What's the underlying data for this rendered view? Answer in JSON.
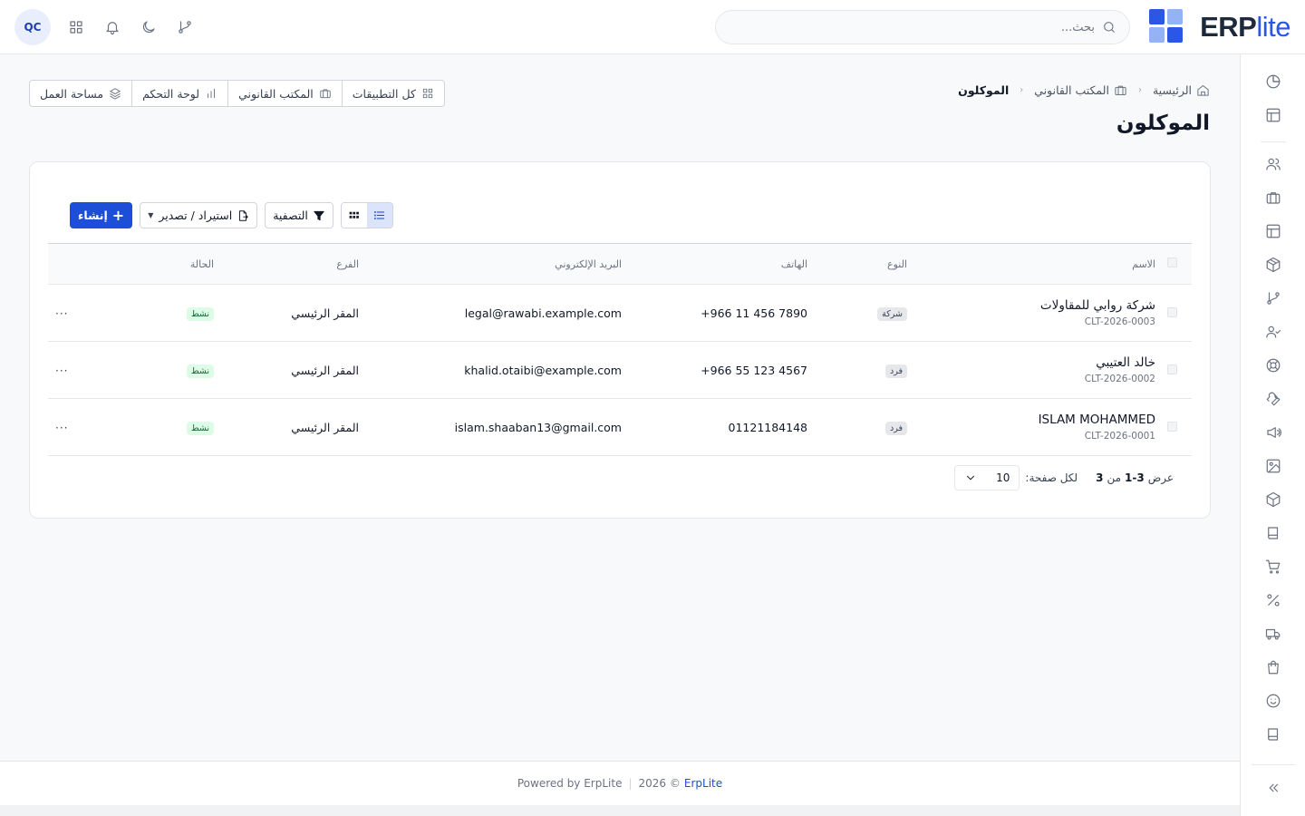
{
  "brand": {
    "name_main": "ERP",
    "name_accent": "lite",
    "colors": {
      "accent": "#2b56e6",
      "dark": "#1e293b"
    }
  },
  "header": {
    "search_placeholder": "بحث...",
    "avatar_initials": "QC",
    "icons": [
      "grid-icon",
      "bell-icon",
      "moon-icon",
      "git-branch-icon"
    ]
  },
  "breadcrumb": {
    "home": "الرئيسية",
    "section": "المكتب القانوني",
    "current": "الموكلون"
  },
  "page_title": "الموكلون",
  "quick_links": {
    "all_apps": "كل التطبيقات",
    "legal_office": "المكتب القانوني",
    "dashboard": "لوحة التحكم",
    "workspace": "مساحة العمل"
  },
  "toolbar": {
    "create": "إنشاء",
    "import_export": "استيراد / تصدير",
    "filter": "التصفية"
  },
  "table": {
    "columns": {
      "name": "الاسم",
      "type": "النوع",
      "phone": "الهاتف",
      "email": "البريد الإلكتروني",
      "branch": "الفرع",
      "status": "الحالة"
    },
    "rows": [
      {
        "name": "شركة روابي للمقاولات",
        "code": "CLT-2026-0003",
        "type": "شركة",
        "phone": "+966 11 456 7890",
        "email": "legal@rawabi.example.com",
        "branch": "المقر الرئيسي",
        "status": "نشط",
        "more": "···"
      },
      {
        "name": "خالد العتيبي",
        "code": "CLT-2026-0002",
        "type": "فرد",
        "phone": "+966 55 123 4567",
        "email": "khalid.otaibi@example.com",
        "branch": "المقر الرئيسي",
        "status": "نشط",
        "more": "···"
      },
      {
        "name": "ISLAM MOHAMMED",
        "code": "CLT-2026-0001",
        "type": "فرد",
        "phone": "01121184148",
        "email": "islam.shaaban13@gmail.com",
        "branch": "المقر الرئيسي",
        "status": "نشط",
        "more": "···"
      }
    ]
  },
  "pagination": {
    "show": "عرض",
    "range": "1-3",
    "of": "من",
    "total": "3",
    "per_page_label": "لكل صفحة:",
    "per_page_value": "10"
  },
  "footer": {
    "powered": "Powered by ErpLite",
    "year": "2026 ©",
    "brand": "ErpLite"
  },
  "sidebar_icons": [
    "pie-chart-icon",
    "layout-icon",
    "users-icon",
    "briefcase-icon",
    "layout-icon",
    "box-icon",
    "git-branch-icon",
    "user-check-icon",
    "life-buoy-icon",
    "wrench-icon",
    "megaphone-icon",
    "image-icon",
    "package-icon",
    "book-icon",
    "cart-icon",
    "percent-icon",
    "truck-icon",
    "shopping-bag-icon",
    "smile-icon",
    "book-icon",
    "collapse-icon"
  ]
}
